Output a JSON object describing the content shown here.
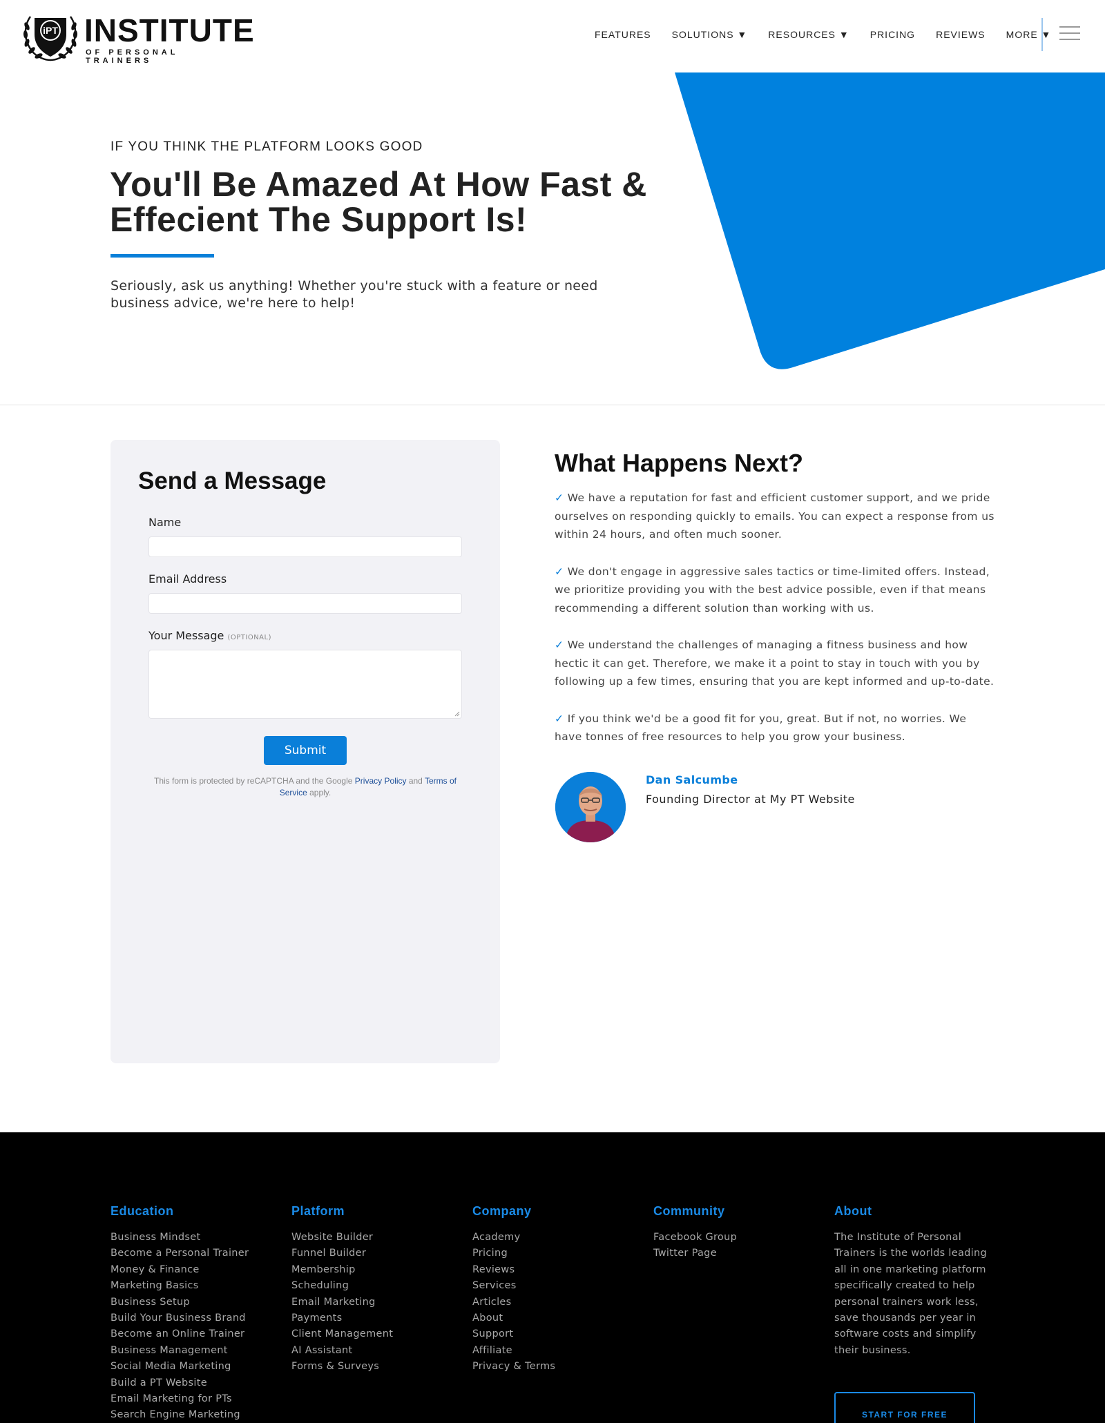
{
  "brand": {
    "badge_text": "iPT",
    "name": "INSTITUTE",
    "tagline": "OF PERSONAL TRAINERS"
  },
  "nav": {
    "items": [
      {
        "label": "FEATURES"
      },
      {
        "label": "SOLUTIONS ▼"
      },
      {
        "label": "RESOURCES ▼"
      },
      {
        "label": "PRICING"
      },
      {
        "label": "REVIEWS"
      },
      {
        "label": "MORE ▼"
      }
    ],
    "menu_icon": "hamburger-icon"
  },
  "hero": {
    "eyebrow": "IF YOU THINK THE PLATFORM LOOKS GOOD",
    "title": "You'll Be Amazed At How Fast & Effecient The Support Is!",
    "body": "Seriously, ask us anything! Whether you're stuck with a feature or need business advice, we're here to help!"
  },
  "form": {
    "title": "Send a Message",
    "name_label": "Name",
    "name_value": "",
    "email_label": "Email Address",
    "email_value": "",
    "message_label": "Your Message",
    "message_optional": "(OPTIONAL)",
    "message_value": "",
    "submit_label": "Submit",
    "recaptcha_prefix": "This form is protected by reCAPTCHA and the Google",
    "privacy_link": "Privacy Policy",
    "and_text": "and",
    "terms_link": "Terms of Service",
    "recaptcha_suffix": "apply."
  },
  "next": {
    "title": "What Happens Next?",
    "check_mark": "✓",
    "items": [
      "We have a reputation for fast and efficient customer support, and we pride ourselves on responding quickly to emails. You can expect a response from us within 24 hours, and often much sooner.",
      "We don't engage in aggressive sales tactics or time-limited offers. Instead, we prioritize providing you with the best advice possible, even if that means recommending a different solution than working with us.",
      "We understand the challenges of managing a fitness business and how hectic it can get. Therefore, we make it a point to stay in touch with you by following up a few times, ensuring that you are kept informed and up-to-date.",
      "If you think we'd be a good fit for you, great. But if not, no worries. We have tonnes of free resources to help you grow your business."
    ],
    "author_name": "Dan Salcumbe",
    "author_role": "Founding Director at My PT Website"
  },
  "footer": {
    "education": {
      "title": "Education",
      "links": [
        "Business Mindset",
        "Become a Personal Trainer",
        "Money & Finance",
        "Marketing Basics",
        "Business Setup",
        "Build Your Business Brand",
        "Become an Online Trainer",
        "Business Management",
        "Social Media Marketing",
        "Build a PT Website",
        "Email Marketing for PTs",
        "Search Engine Marketing"
      ]
    },
    "platform": {
      "title": "Platform",
      "links": [
        "Website Builder",
        "Funnel Builder",
        "Membership",
        "Scheduling",
        "Email Marketing",
        "Payments",
        "Client Management",
        "AI Assistant",
        "Forms & Surveys"
      ]
    },
    "company": {
      "title": "Company",
      "links": [
        "Academy",
        "Pricing",
        "Reviews",
        "Services",
        "Articles",
        "About",
        "Support",
        "Affiliate",
        "Privacy & Terms"
      ]
    },
    "community": {
      "title": "Community",
      "links": [
        "Facebook Group",
        "Twitter Page"
      ]
    },
    "about": {
      "title": "About",
      "text": "The Institute of Personal Trainers is the worlds leading all in one marketing platform specifically created to help personal trainers work less, save thousands per year in software costs and simplify their business.",
      "cta_label": "START FOR FREE"
    }
  },
  "colors": {
    "accent": "#0a7fd9",
    "footer_bg": "#000000",
    "card_bg": "#f2f2f6"
  }
}
